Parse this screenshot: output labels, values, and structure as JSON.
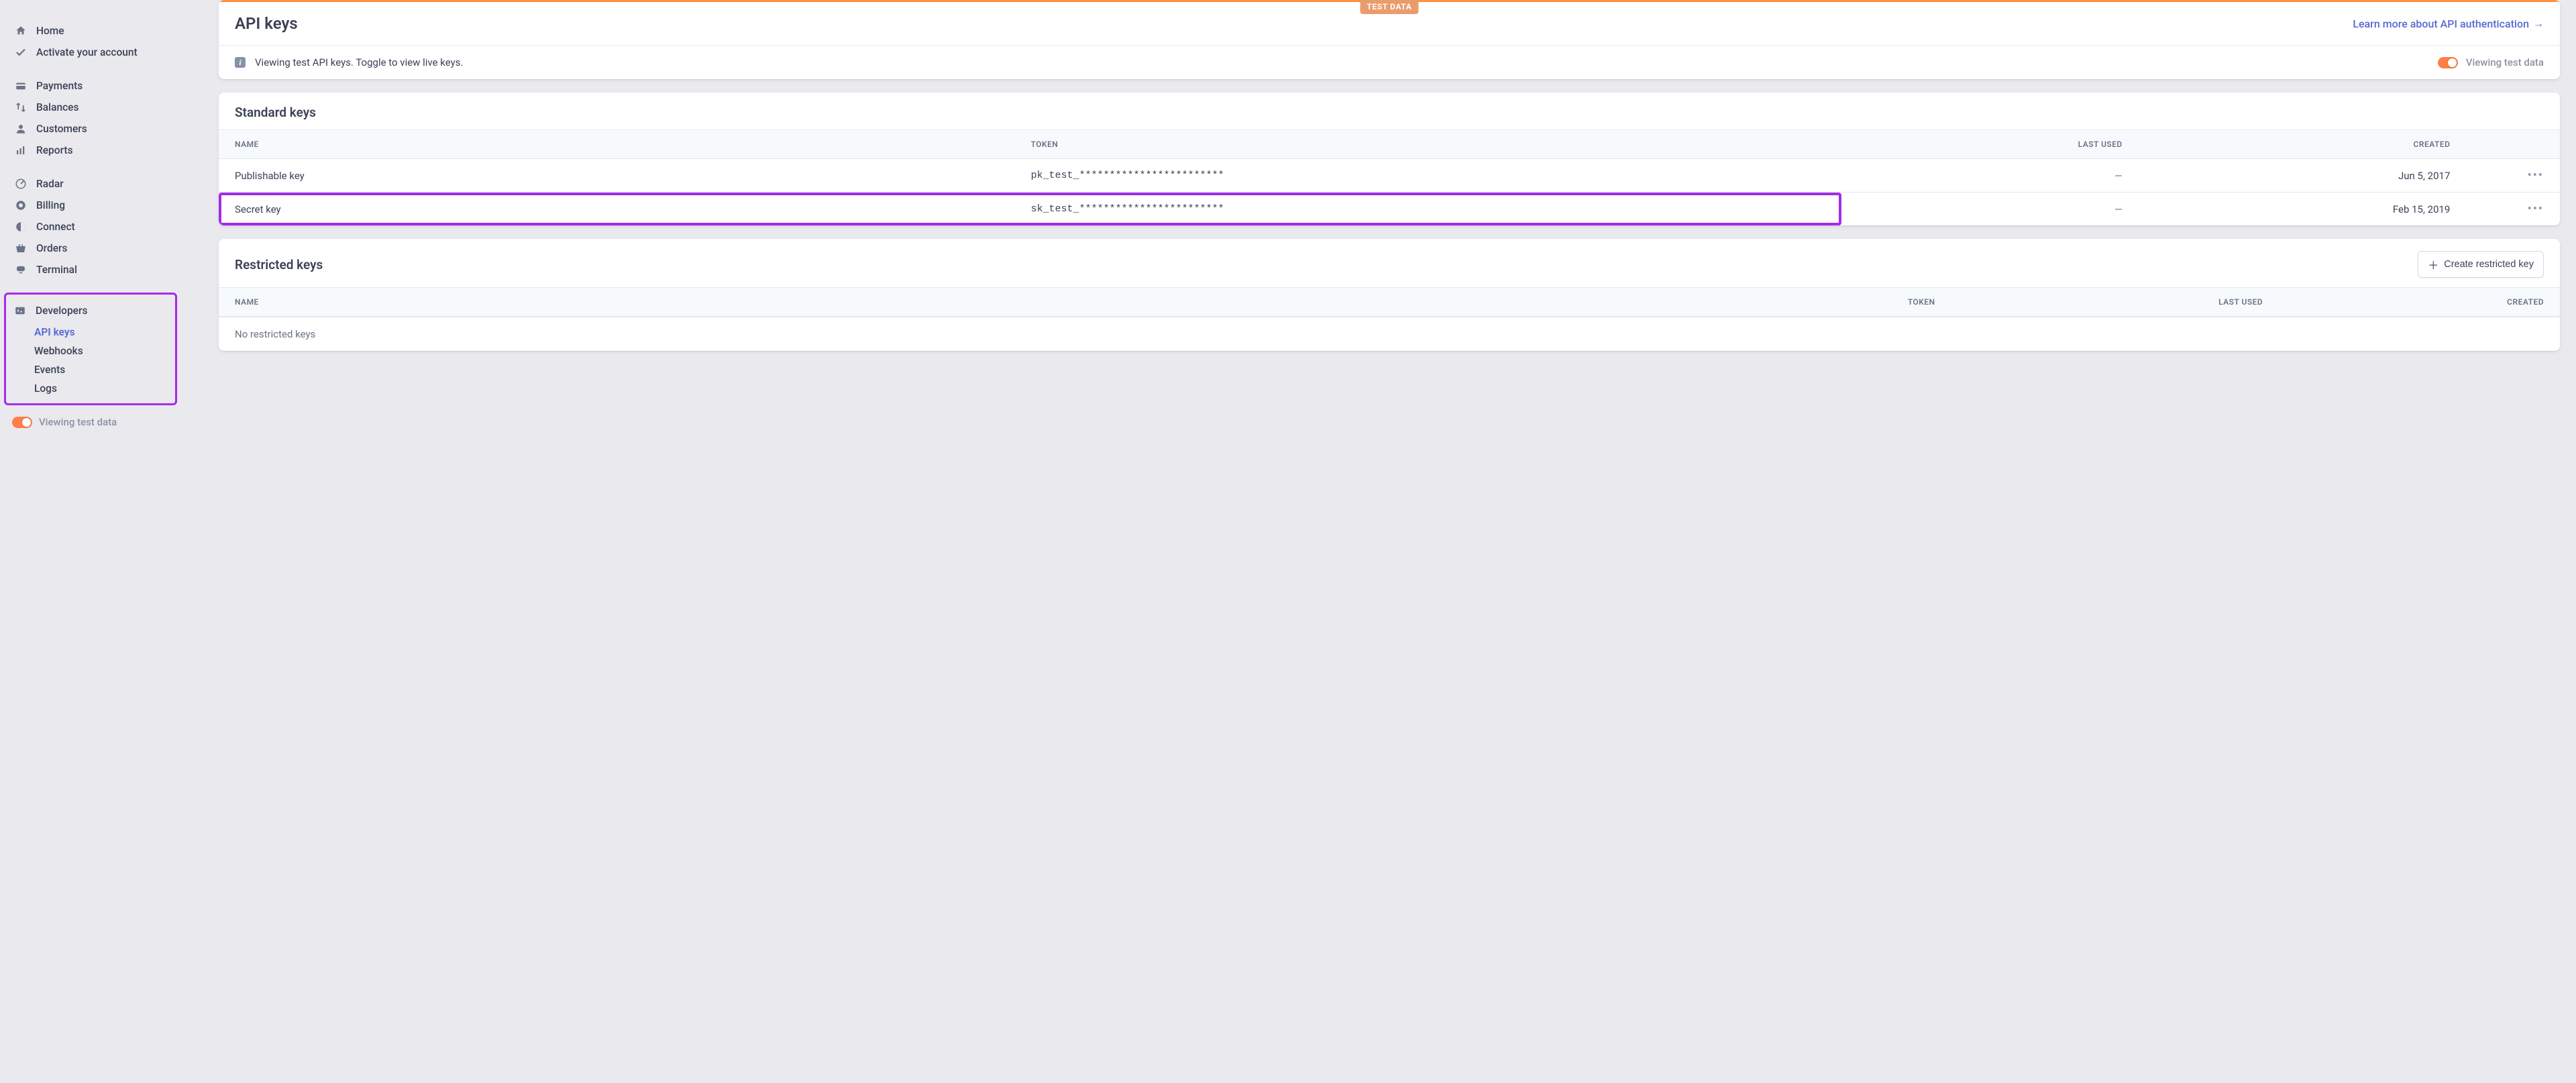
{
  "sidebar": {
    "items": [
      {
        "id": "home",
        "label": "Home"
      },
      {
        "id": "activate",
        "label": "Activate your account"
      },
      {
        "id": "payments",
        "label": "Payments"
      },
      {
        "id": "balances",
        "label": "Balances"
      },
      {
        "id": "customers",
        "label": "Customers"
      },
      {
        "id": "reports",
        "label": "Reports"
      },
      {
        "id": "radar",
        "label": "Radar"
      },
      {
        "id": "billing",
        "label": "Billing"
      },
      {
        "id": "connect",
        "label": "Connect"
      },
      {
        "id": "orders",
        "label": "Orders"
      },
      {
        "id": "terminal",
        "label": "Terminal"
      },
      {
        "id": "developers",
        "label": "Developers"
      }
    ],
    "dev_children": [
      {
        "id": "api-keys",
        "label": "API keys",
        "active": true
      },
      {
        "id": "webhooks",
        "label": "Webhooks"
      },
      {
        "id": "events",
        "label": "Events"
      },
      {
        "id": "logs",
        "label": "Logs"
      }
    ],
    "viewing_test_label": "Viewing test data"
  },
  "header": {
    "test_badge": "TEST DATA",
    "title": "API keys",
    "learn_more_link": "Learn more about API authentication",
    "info_text": "Viewing test API keys. Toggle to view live keys.",
    "viewing_test_label": "Viewing test data"
  },
  "standard_keys": {
    "title": "Standard keys",
    "columns": {
      "name": "NAME",
      "token": "TOKEN",
      "last_used": "LAST USED",
      "created": "CREATED"
    },
    "rows": [
      {
        "name": "Publishable key",
        "token": "pk_test_************************",
        "last_used": "—",
        "created": "Jun 5, 2017",
        "highlight": false
      },
      {
        "name": "Secret key",
        "token": "sk_test_************************",
        "last_used": "—",
        "created": "Feb 15, 2019",
        "highlight": true
      }
    ]
  },
  "restricted_keys": {
    "title": "Restricted keys",
    "create_btn": "Create restricted key",
    "columns": {
      "name": "NAME",
      "token": "TOKEN",
      "last_used": "LAST USED",
      "created": "CREATED"
    },
    "empty_text": "No restricted keys"
  }
}
